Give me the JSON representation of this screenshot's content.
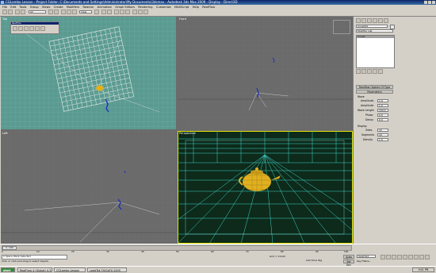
{
  "window": {
    "title": "CGLambo Lesson - Project Folder: C:\\Documents and Settings\\Administrator\\My Documents\\3dsmax - Autodesk 3ds Max 2009 - Display : Direct3D"
  },
  "menu": [
    "File",
    "Edit",
    "Tools",
    "Group",
    "Views",
    "Create",
    "Modifiers",
    "Reactor",
    "Animation",
    "Graph Editors",
    "Rendering",
    "Customize",
    "MAXScript",
    "Help",
    "RealFlow"
  ],
  "toolbar": {
    "view_dropdown": "All",
    "zoom_field": "View"
  },
  "viewports": {
    "top": {
      "label": "Top",
      "floating_panel_title": "RealFlow"
    },
    "front": {
      "label": "Front"
    },
    "left": {
      "label": "Left"
    },
    "perspective": {
      "label": "Perspective"
    }
  },
  "command_panel": {
    "object_name": "Crowd01",
    "modifier_list": "Modifier List",
    "stack_item": "Crowd",
    "rollout_title": "Realflow Objects Of Type",
    "parameters_title": "Parameters",
    "wave_group": "Wave",
    "params": [
      {
        "label": "Amplitude",
        "value": "1.0"
      },
      {
        "label": "Amplitude",
        "value": "1.0"
      },
      {
        "label": "Wave Length",
        "value": "100.0"
      },
      {
        "label": "Phase",
        "value": "0.0"
      },
      {
        "label": "Decay",
        "value": "0.0"
      }
    ],
    "display_group": "Display",
    "display_params": [
      {
        "label": "Sides",
        "value": "10"
      },
      {
        "label": "Segments",
        "value": "10"
      },
      {
        "label": "Density",
        "value": "1.0"
      }
    ]
  },
  "status": {
    "frame_counter": "0 / 100",
    "selection": "1 Space Warp Selected",
    "prompt": "Click or click-and-drag to select objects",
    "grid": "Grid = 10.0m",
    "add_time_tag": "Add Time Tag",
    "auto_key": "Auto Key",
    "set_key": "Set Key",
    "selected": "Selected",
    "key_filters": "Key Filters...",
    "timeline_ticks": [
      "0",
      "10",
      "20",
      "30",
      "40",
      "50",
      "60",
      "70",
      "80",
      "90",
      "100"
    ]
  },
  "taskbar": {
    "start": "start",
    "tasks": [
      "RealFlow 4 (Global) 4.3.8",
      "CGLambo Lesson",
      "LeadTek FX/GeFX 2009"
    ],
    "clock": "9:41 PM"
  },
  "colors": {
    "viewport_bg": "#6b6b6b",
    "teal_viewport": "#5a9a90",
    "persp_bg": "#0d2a1a",
    "grid_cyan": "#3fd6cc",
    "teapot": "#e0b020",
    "active_border": "#e6e600"
  }
}
